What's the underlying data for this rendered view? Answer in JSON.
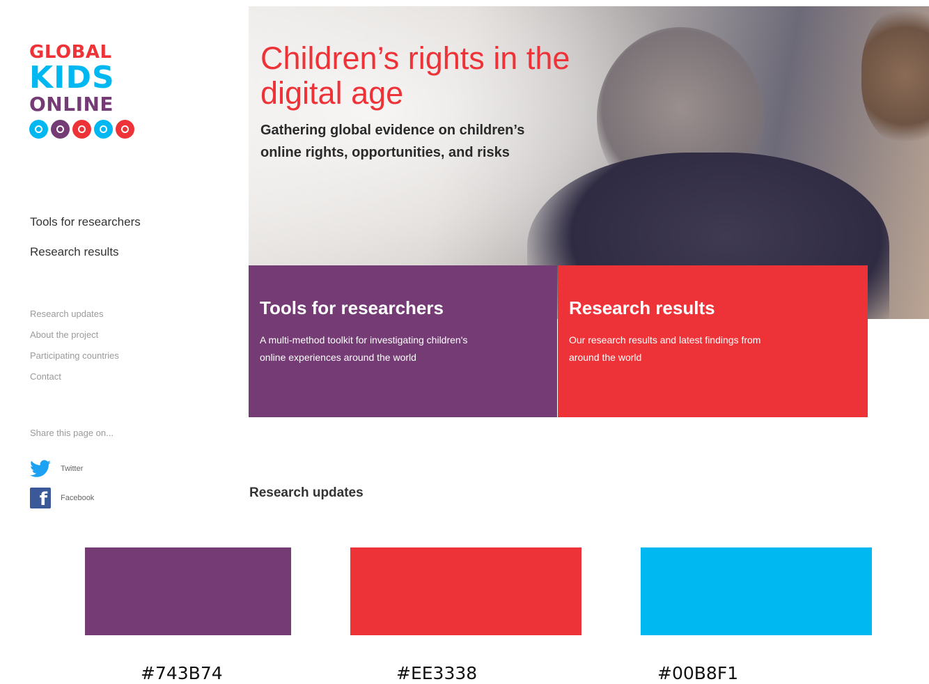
{
  "logo": {
    "line1": "GLOBAL",
    "line2": "KIDS",
    "line3": "ONLINE",
    "dot_colors": [
      "#00B8F1",
      "#743B74",
      "#EE3338",
      "#00B8F1",
      "#EE3338"
    ]
  },
  "nav_primary": [
    "Tools for researchers",
    "Research results"
  ],
  "nav_secondary": [
    "Research updates",
    "About the project",
    "Participating countries",
    "Contact"
  ],
  "share": {
    "label": "Share this page on...",
    "twitter": "Twitter",
    "facebook": "Facebook"
  },
  "hero": {
    "title": "Children’s rights in the digital age",
    "subtitle": "Gathering global evidence on children’s online rights, opportunities, and risks"
  },
  "cards": [
    {
      "title": "Tools for researchers",
      "desc": "A multi-method toolkit for investigating children's online experiences around the world",
      "color": "#743B74"
    },
    {
      "title": "Research results",
      "desc": "Our research results and latest findings from around the world",
      "color": "#EE3338"
    }
  ],
  "updates_title": "Research updates",
  "swatches": [
    {
      "color": "#743B74",
      "label": "#743B74"
    },
    {
      "color": "#EE3338",
      "label": "#EE3338"
    },
    {
      "color": "#00B8F1",
      "label": "#00B8F1"
    }
  ]
}
